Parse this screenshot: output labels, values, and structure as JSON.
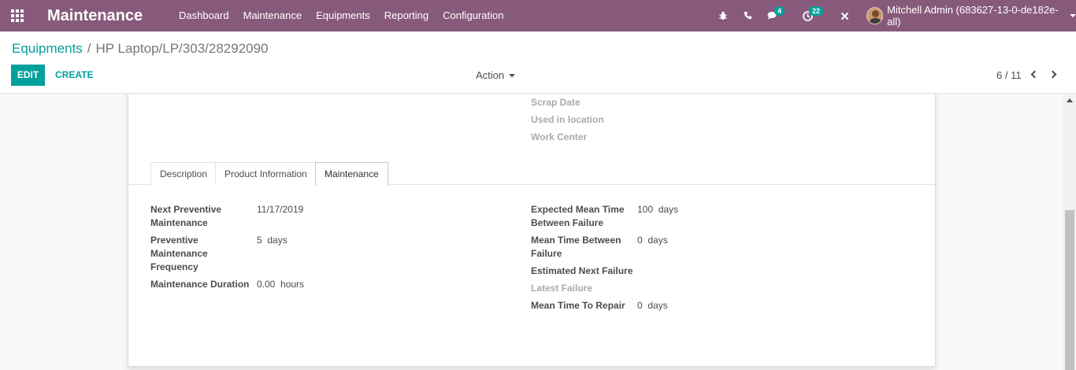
{
  "navbar": {
    "app_title": "Maintenance",
    "menu": [
      "Dashboard",
      "Maintenance",
      "Equipments",
      "Reporting",
      "Configuration"
    ],
    "messages_badge": "4",
    "activities_badge": "22",
    "user_name": "Mitchell Admin (683627-13-0-de182e-all)",
    "icons": [
      "apps-icon",
      "bug-icon",
      "phone-icon",
      "chat-icon",
      "clock-icon",
      "close-icon"
    ]
  },
  "breadcrumb": {
    "parent": "Equipments",
    "separator": "/",
    "current": "HP Laptop/LP/303/28292090"
  },
  "buttons": {
    "edit": "EDIT",
    "create": "CREATE",
    "action": "Action"
  },
  "pager": {
    "value": "6 / 11"
  },
  "top_fields": {
    "scrap_date": "Scrap Date",
    "used_in_location": "Used in location",
    "work_center": "Work Center"
  },
  "tabs": [
    "Description",
    "Product Information",
    "Maintenance"
  ],
  "active_tab": "Maintenance",
  "maintenance_left": {
    "next_preventive_label_1": "Next Preventive",
    "next_preventive_label_2": "Maintenance",
    "next_preventive_value": "11/17/2019",
    "frequency_label_1": "Preventive",
    "frequency_label_2": "Maintenance",
    "frequency_label_3": "Frequency",
    "frequency_value": "5",
    "frequency_unit": "days",
    "duration_label": "Maintenance Duration",
    "duration_value": "0.00",
    "duration_unit": "hours"
  },
  "maintenance_right": {
    "mtbf_label_1": "Expected Mean Time",
    "mtbf_label_2": "Between Failure",
    "mtbf_value": "100",
    "mtbf_unit": "days",
    "mean_time_label_1": "Mean Time Between",
    "mean_time_label_2": "Failure",
    "mean_time_value": "0",
    "mean_time_unit": "days",
    "next_failure_label": "Estimated Next Failure",
    "latest_failure_label": "Latest Failure",
    "mttr_label": "Mean Time To Repair",
    "mttr_value": "0",
    "mttr_unit": "days"
  },
  "colors": {
    "navbar": "#875a7b",
    "accent": "#00a09d"
  }
}
